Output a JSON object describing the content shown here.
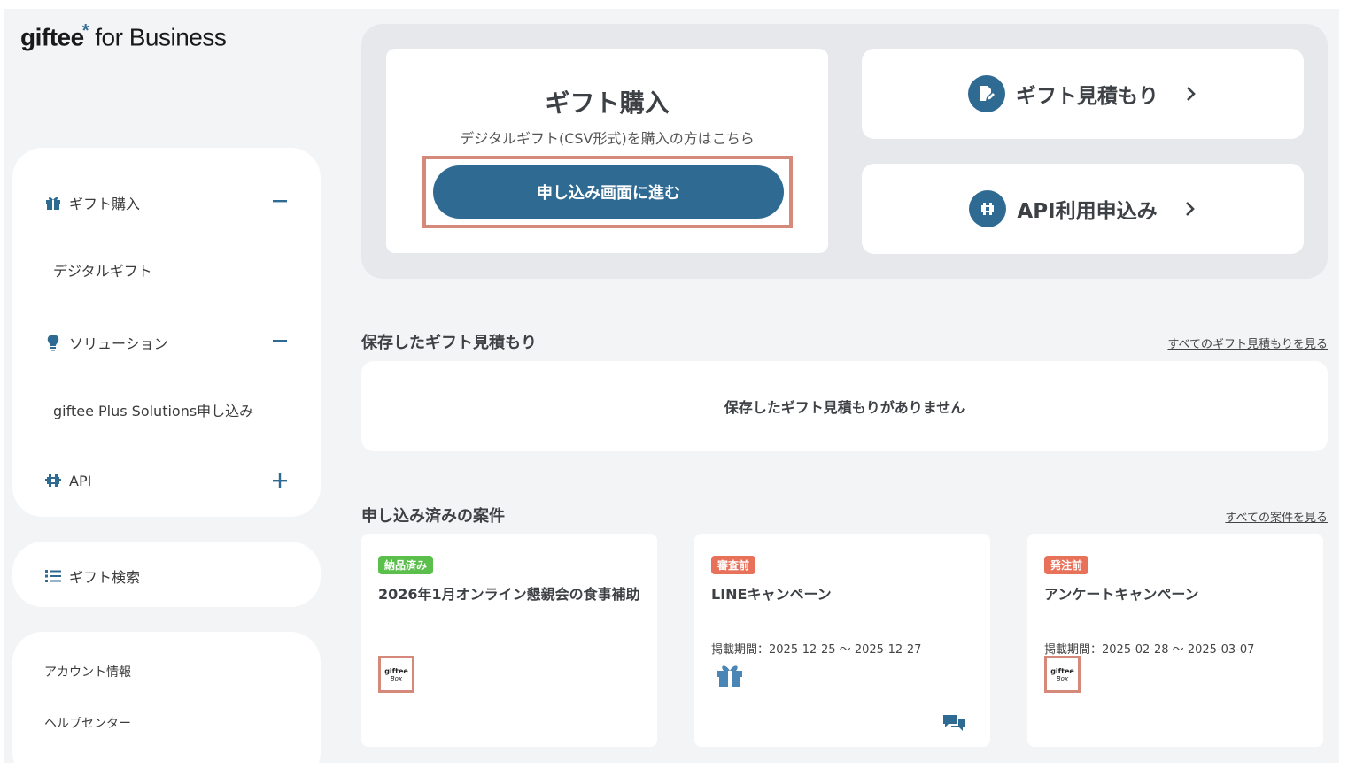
{
  "logo": {
    "brand": "giftee",
    "star": "*",
    "rest": " for Business"
  },
  "sidebar": {
    "sections": [
      {
        "label": "ギフト購入",
        "icon": "gift-icon",
        "toggle": "minus-icon"
      },
      {
        "label": "ソリューション",
        "icon": "lightbulb-icon",
        "toggle": "minus-icon"
      },
      {
        "label": "API",
        "icon": "puzzle-icon",
        "toggle": "plus-icon"
      }
    ],
    "sub_items": [
      "デジタルギフト",
      "giftee Plus Solutions申し込み"
    ],
    "search": {
      "label": "ギフト検索",
      "icon": "list-icon"
    },
    "account": [
      "アカウント情報",
      "ヘルプセンター"
    ]
  },
  "purchase": {
    "title": "ギフト購入",
    "subtitle": "デジタルギフト(CSV形式)を購入の方はこちら",
    "button": "申し込み画面に進む"
  },
  "quick_links": [
    {
      "label": "ギフト見積もり",
      "icon": "edit-document-icon"
    },
    {
      "label": "API利用申込み",
      "icon": "puzzle-icon"
    }
  ],
  "saved_estimates": {
    "title": "保存したギフト見積もり",
    "link": "すべてのギフト見積もりを見る",
    "empty": "保存したギフト見積もりがありません"
  },
  "cases": {
    "title": "申し込み済みの案件",
    "link": "すべての案件を見る",
    "items": [
      {
        "status": "納品済み",
        "status_color": "#5bbf4c",
        "title": "2026年1月オンライン懇親会の食事補助",
        "period": "",
        "thumb": "giftee-box",
        "box_t1": "giftee",
        "box_t2": "Box"
      },
      {
        "status": "審査前",
        "status_color": "#e8715a",
        "title": "LINEキャンペーン",
        "period": "掲載期間：2025-12-25 〜 2025-12-27",
        "thumb": "gift-icon"
      },
      {
        "status": "発注前",
        "status_color": "#e8715a",
        "title": "アンケートキャンペーン",
        "period": "掲載期間：2025-02-28 〜 2025-03-07",
        "thumb": "giftee-box",
        "box_t1": "giftee",
        "box_t2": "Box"
      }
    ]
  },
  "colors": {
    "primary": "#2f6a92",
    "highlight": "#d4897a",
    "background": "#f3f4f6"
  }
}
